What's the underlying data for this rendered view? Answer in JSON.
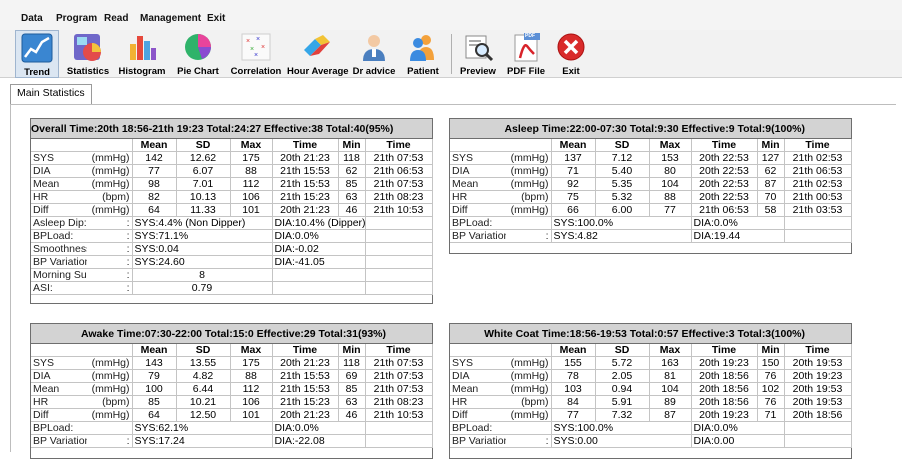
{
  "menu": [
    "Data",
    "Program",
    "Read",
    "Management",
    "Exit"
  ],
  "toolbar": [
    {
      "label": "Trend",
      "icon": "trend-icon"
    },
    {
      "label": "Statistics",
      "icon": "statistics-icon"
    },
    {
      "label": "Histogram",
      "icon": "histogram-icon"
    },
    {
      "label": "Pie Chart",
      "icon": "pie-chart-icon"
    },
    {
      "label": "Correlation",
      "icon": "correlation-icon"
    },
    {
      "label": "Hour Average",
      "icon": "hour-average-icon"
    },
    {
      "label": "Dr advice",
      "icon": "doctor-icon"
    },
    {
      "label": "Patient",
      "icon": "patient-icon"
    },
    {
      "label": "Preview",
      "icon": "preview-icon"
    },
    {
      "label": "PDF File",
      "icon": "pdf-icon",
      "badge": "PDF"
    },
    {
      "label": "Exit",
      "icon": "exit-icon"
    }
  ],
  "tab": "Main Statistics",
  "columns": [
    "Mean",
    "SD",
    "Max",
    "Time",
    "Min",
    "Time"
  ],
  "overall": {
    "title": "Overall  Time:20th 18:56-21th 19:23  Total:24:27  Effective:38  Total:40(95%)",
    "rows": [
      {
        "name": "SYS",
        "unit": "(mmHg)",
        "vals": [
          "142",
          "12.62",
          "175",
          "20th 21:23",
          "118",
          "21th 07:53"
        ]
      },
      {
        "name": "DIA",
        "unit": "(mmHg)",
        "vals": [
          "77",
          "6.07",
          "88",
          "21th 15:53",
          "62",
          "21th 06:53"
        ]
      },
      {
        "name": "Mean",
        "unit": "(mmHg)",
        "vals": [
          "98",
          "7.01",
          "112",
          "21th 15:53",
          "85",
          "21th 07:53"
        ]
      },
      {
        "name": "HR",
        "unit": "(bpm)",
        "vals": [
          "82",
          "10.13",
          "106",
          "21th 15:23",
          "63",
          "21th 08:23"
        ]
      },
      {
        "name": "Diff",
        "unit": "(mmHg)",
        "vals": [
          "64",
          "11.33",
          "101",
          "20th 21:23",
          "46",
          "21th 10:53"
        ]
      }
    ],
    "asleep_dip": {
      "label": "Asleep Dip:",
      "colon": ":",
      "sys": "SYS:4.4% (Non Dipper)",
      "dia": "DIA:10.4% (Dipper)"
    },
    "bpload": {
      "label": "BPLoad:",
      "colon": ":",
      "sys": "SYS:71.1%",
      "dia": "DIA:0.0%"
    },
    "smooth": {
      "label": "Smoothness Index:",
      "colon": ":",
      "sys": "SYS:0.04",
      "dia": "DIA:-0.02"
    },
    "bpvar": {
      "label": "BP Variation Corr",
      "colon": ":",
      "sys": "SYS:24.60",
      "dia": "DIA:-41.05"
    },
    "surge": {
      "label": "Morning Surge:",
      "colon": ":",
      "value": "8"
    },
    "asi": {
      "label": "ASI:",
      "colon": ":",
      "value": "0.79"
    }
  },
  "asleep": {
    "title": "Asleep  Time:22:00-07:30  Total:9:30  Effective:9  Total:9(100%)",
    "rows": [
      {
        "name": "SYS",
        "unit": "(mmHg)",
        "vals": [
          "137",
          "7.12",
          "153",
          "20th 22:53",
          "127",
          "21th 02:53"
        ]
      },
      {
        "name": "DIA",
        "unit": "(mmHg)",
        "vals": [
          "71",
          "5.40",
          "80",
          "20th 22:53",
          "62",
          "21th 06:53"
        ]
      },
      {
        "name": "Mean",
        "unit": "(mmHg)",
        "vals": [
          "92",
          "5.35",
          "104",
          "20th 22:53",
          "87",
          "21th 02:53"
        ]
      },
      {
        "name": "HR",
        "unit": "(bpm)",
        "vals": [
          "75",
          "5.32",
          "88",
          "20th 22:53",
          "70",
          "21th 00:53"
        ]
      },
      {
        "name": "Diff",
        "unit": "(mmHg)",
        "vals": [
          "66",
          "6.00",
          "77",
          "21th 06:53",
          "58",
          "21th 03:53"
        ]
      }
    ],
    "bpload": {
      "label": "BPLoad:",
      "sys": "SYS:100.0%",
      "dia": "DIA:0.0%"
    },
    "bpvar": {
      "label": "BP Variation Corr",
      "colon": ":",
      "sys": "SYS:4.82",
      "dia": "DIA:19.44"
    }
  },
  "awake": {
    "title": "Awake  Time:07:30-22:00  Total:15:0  Effective:29  Total:31(93%)",
    "rows": [
      {
        "name": "SYS",
        "unit": "(mmHg)",
        "vals": [
          "143",
          "13.55",
          "175",
          "20th 21:23",
          "118",
          "21th 07:53"
        ]
      },
      {
        "name": "DIA",
        "unit": "(mmHg)",
        "vals": [
          "79",
          "4.82",
          "88",
          "21th 15:53",
          "69",
          "21th 07:53"
        ]
      },
      {
        "name": "Mean",
        "unit": "(mmHg)",
        "vals": [
          "100",
          "6.44",
          "112",
          "21th 15:53",
          "85",
          "21th 07:53"
        ]
      },
      {
        "name": "HR",
        "unit": "(bpm)",
        "vals": [
          "85",
          "10.21",
          "106",
          "21th 15:23",
          "63",
          "21th 08:23"
        ]
      },
      {
        "name": "Diff",
        "unit": "(mmHg)",
        "vals": [
          "64",
          "12.50",
          "101",
          "20th 21:23",
          "46",
          "21th 10:53"
        ]
      }
    ],
    "bpload": {
      "label": "BPLoad:",
      "sys": "SYS:62.1%",
      "dia": "DIA:0.0%"
    },
    "bpvar": {
      "label": "BP Variation Corr",
      "colon": ":",
      "sys": "SYS:17.24",
      "dia": "DIA:-22.08"
    }
  },
  "whitecoat": {
    "title": "White Coat  Time:18:56-19:53  Total:0:57  Effective:3  Total:3(100%)",
    "rows": [
      {
        "name": "SYS",
        "unit": "(mmHg)",
        "vals": [
          "155",
          "5.72",
          "163",
          "20th 19:23",
          "150",
          "20th 19:53"
        ]
      },
      {
        "name": "DIA",
        "unit": "(mmHg)",
        "vals": [
          "78",
          "2.05",
          "81",
          "20th 18:56",
          "76",
          "20th 19:23"
        ]
      },
      {
        "name": "Mean",
        "unit": "(mmHg)",
        "vals": [
          "103",
          "0.94",
          "104",
          "20th 18:56",
          "102",
          "20th 19:53"
        ]
      },
      {
        "name": "HR",
        "unit": "(bpm)",
        "vals": [
          "84",
          "5.91",
          "89",
          "20th 18:56",
          "76",
          "20th 19:53"
        ]
      },
      {
        "name": "Diff",
        "unit": "(mmHg)",
        "vals": [
          "77",
          "7.32",
          "87",
          "20th 19:23",
          "71",
          "20th 18:56"
        ]
      }
    ],
    "bpload": {
      "label": "BPLoad:",
      "sys": "SYS:100.0%",
      "dia": "DIA:0.0%"
    },
    "bpvar": {
      "label": "BP Variation Corr",
      "colon": ":",
      "sys": "SYS:0.00",
      "dia": "DIA:0.00"
    }
  },
  "colors": {
    "header_bg": "#d3d3d3",
    "selected_tool": "#dbe6f2",
    "exit_red": "#d92b2b"
  }
}
